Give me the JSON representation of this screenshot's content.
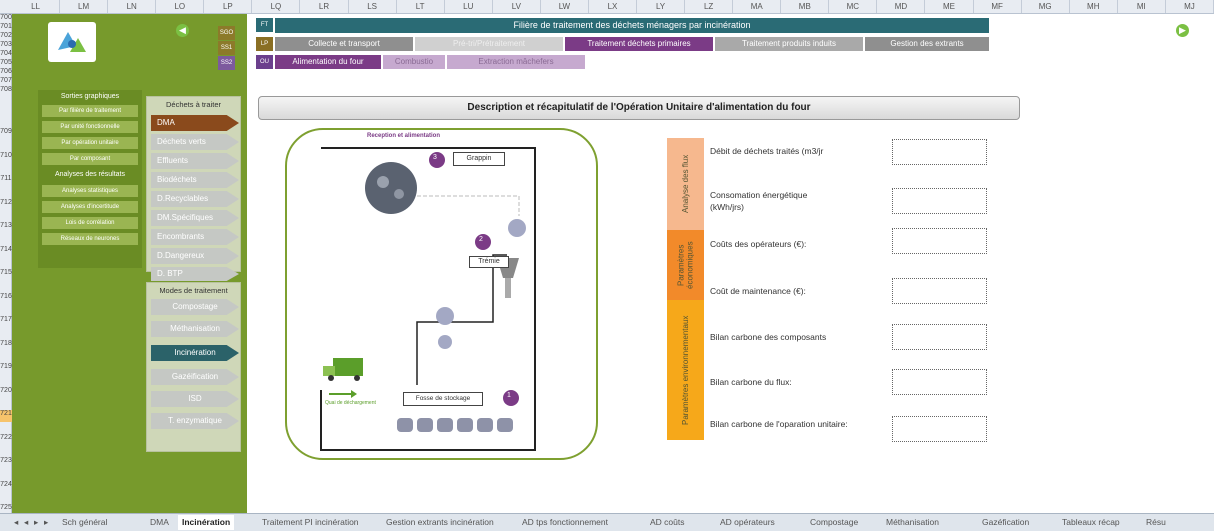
{
  "columns": [
    "LL",
    "LM",
    "LN",
    "LO",
    "LP",
    "LQ",
    "LR",
    "LS",
    "LT",
    "LU",
    "LV",
    "LW",
    "LX",
    "LY",
    "LZ",
    "MA",
    "MB",
    "MC",
    "MD",
    "ME",
    "MF",
    "MG",
    "MH",
    "MI",
    "MJ"
  ],
  "rows": {
    "top": [
      "700",
      "701",
      "702",
      "703",
      "704",
      "705",
      "706",
      "707",
      "708"
    ],
    "main": [
      "709",
      "710",
      "711",
      "712",
      "713",
      "714",
      "715",
      "716",
      "717",
      "718",
      "719",
      "720",
      "721",
      "722",
      "723",
      "724",
      "725"
    ],
    "selected": "721"
  },
  "topnav": {
    "title": "Filière de traitement des déchets ménagers par incinération",
    "tags": {
      "ft": "FT",
      "lp": "LP",
      "ou": "OU",
      "sgo": "SGO",
      "ss1": "SS1",
      "ss2": "SS2"
    },
    "row1": [
      "Collecte et transport",
      "Pré-tri/Prétraitement",
      "Traitement déchets primaires",
      "Traitement produits induits",
      "Gestion des extrants"
    ],
    "row2": [
      "Alimentation du four",
      "Combustio",
      "Extraction mâchefers"
    ]
  },
  "sidebar": {
    "sorties_title": "Sorties graphiques",
    "sorties": [
      "Par filière de traitement",
      "Par unité fonctionnelle",
      "Par opération unitaire",
      "Par composant"
    ],
    "analyses_title": "Analyses des résultats",
    "analyses": [
      "Analyses statistiques",
      "Analyses d'incertitude",
      "Lois de corrélation",
      "Réseaux de neurones"
    ]
  },
  "dechets": {
    "title": "Déchets à traiter",
    "items": [
      "DMA",
      "Déchets verts",
      "Effluents",
      "Biodéchets",
      "D.Recyclables",
      "DM.Spécifiques",
      "Encombrants",
      "D.Dangereux",
      "D. BTP"
    ]
  },
  "modes": {
    "title": "Modes de traitement",
    "items": [
      "Compostage",
      "Méthanisation",
      "Incinération",
      "Gazéification",
      "ISD",
      "T. enzymatique"
    ]
  },
  "description": "Description et récapitulatif de l'Opération Unitaire d'alimentation du four",
  "diagram": {
    "title": "Reception et alimentation",
    "grappin": "Grappin",
    "tremie": "Trémie",
    "fosse": "Fosse de stockage",
    "quai": "Quai de déchargement",
    "n1": "1",
    "n2": "2",
    "n3": "3"
  },
  "table": {
    "groups": [
      "Analyse des flux",
      "Paramètres économiques",
      "Paramètres environnementaux"
    ],
    "labels": [
      "Débit de déchets traités (m3/jr",
      "Consomation énergétique (kWh/jrs)",
      "Coûts des opérateurs (€):",
      "Coût de maintenance (€):",
      "Bilan carbone des composants",
      "Bilan carbone du flux:",
      "Bilan carbone de l'oparation unitaire:"
    ],
    "colors": {
      "flux": "#f6b88e",
      "eco": "#f28a2a",
      "env": "#f6a81a"
    }
  },
  "tabs": [
    "Sch général",
    "DMA",
    "Incinération",
    "Traitement PI incinération",
    "Gestion extrants incinération",
    "AD tps fonctionnement",
    "AD coûts",
    "AD opérateurs",
    "Compostage",
    "Méthanisation",
    "Gazéfication",
    "Tableaux récap",
    "Résu"
  ],
  "active_tab": "Incinération",
  "nav_arrows": [
    "◂",
    "◂",
    "▸",
    "▸"
  ]
}
